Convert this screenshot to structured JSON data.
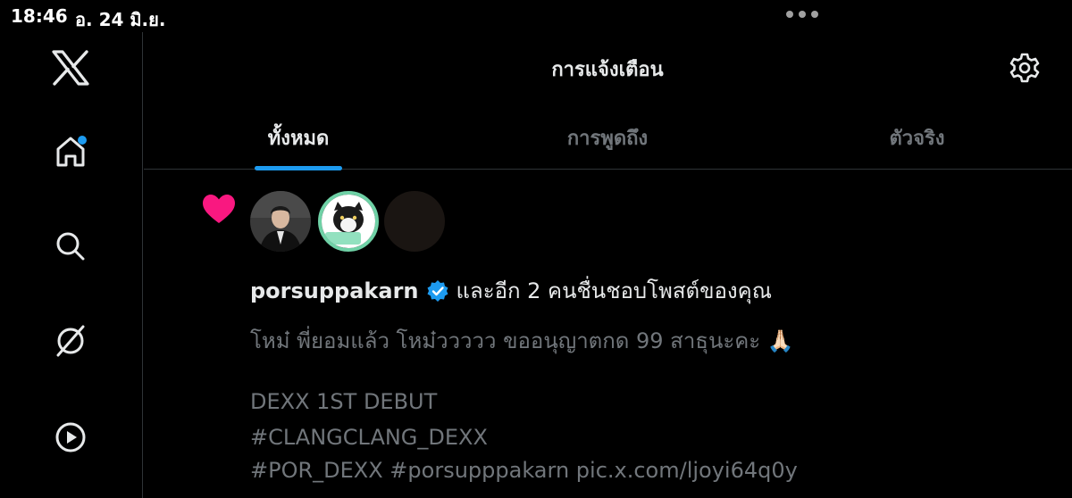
{
  "status_bar": {
    "time": "18:46",
    "date": "อ. 24 มิ.ย."
  },
  "sidebar": {
    "items": [
      {
        "icon": "x-logo-icon"
      },
      {
        "icon": "home-icon",
        "has_badge": true
      },
      {
        "icon": "search-icon"
      },
      {
        "icon": "grok-icon"
      },
      {
        "icon": "play-icon"
      }
    ]
  },
  "header": {
    "title": "การแจ้งเตือน",
    "settings_icon": "gear-icon"
  },
  "tabs": [
    {
      "label": "ทั้งหมด",
      "active": true
    },
    {
      "label": "การพูดถึง",
      "active": false
    },
    {
      "label": "ตัวจริง",
      "active": false
    }
  ],
  "notification": {
    "type_icon": "heart-icon",
    "user": "porsuppakarn",
    "verified": true,
    "action": "และอีก 2 คนชื่นชอบโพสต์ของคุณ",
    "post_lines": [
      "โหม๋ พี่ยอมแล้ว โหม๋ววววว ขออนุญาตกด 99 สาธุนะคะ 🙏🏻",
      "",
      "DEXX 1ST DEBUT",
      "#CLANGCLANG_DEXX",
      "#POR_DEXX #porsupppakarn pic.x.com/ljoyi64q0y"
    ]
  },
  "colors": {
    "accent": "#1d9bf0",
    "like": "#f91880",
    "muted": "#71767b",
    "text": "#e7e9ea",
    "border": "#2f3336"
  }
}
